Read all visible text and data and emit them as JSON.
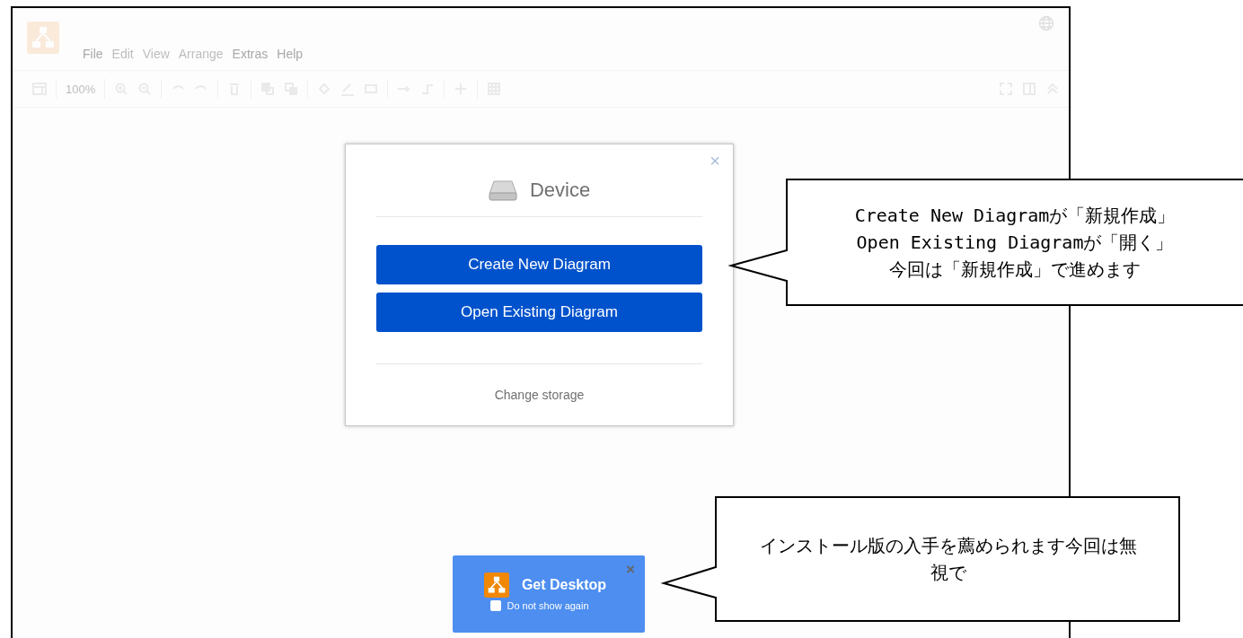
{
  "app": {
    "menu": [
      {
        "label": "File",
        "disabled": false
      },
      {
        "label": "Edit",
        "disabled": true
      },
      {
        "label": "View",
        "disabled": true
      },
      {
        "label": "Arrange",
        "disabled": true
      },
      {
        "label": "Extras",
        "disabled": false
      },
      {
        "label": "Help",
        "disabled": false
      }
    ],
    "toolbar": {
      "zoom": "100%"
    }
  },
  "dialog": {
    "close": "×",
    "title": "Device",
    "buttons": [
      "Create New Diagram",
      "Open Existing Diagram"
    ],
    "link": "Change storage"
  },
  "banner": {
    "close": "×",
    "title": "Get Desktop",
    "checkbox": {
      "label": "Do not show again",
      "checked": false
    }
  },
  "callouts": [
    {
      "lines": [
        "Create New Diagramが「新規作成」",
        "Open Existing Diagramが「開く」",
        "今回は「新規作成」で進めます"
      ]
    },
    {
      "lines": [
        "インストール版の入手を薦められます今回は無視で"
      ]
    }
  ]
}
